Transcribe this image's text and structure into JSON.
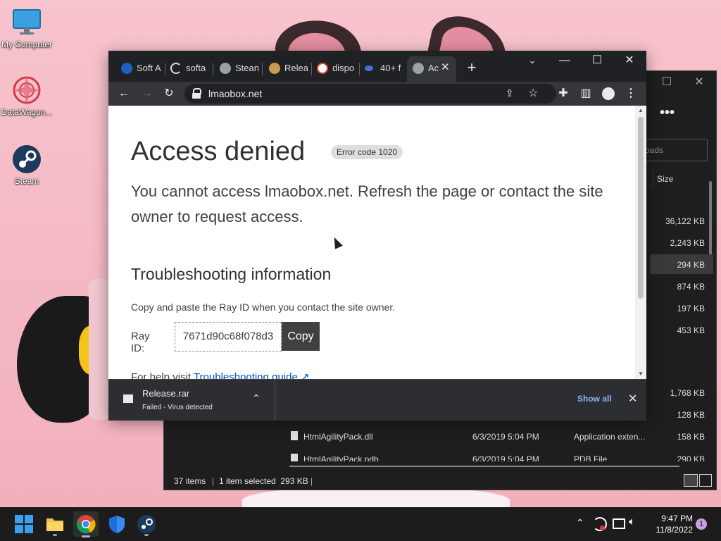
{
  "desktop": {
    "icons": [
      {
        "label": "My Computer",
        "icon": "monitor-icon"
      },
      {
        "label": "DataWagon...",
        "icon": "datawagon-icon"
      },
      {
        "label": "Steam",
        "icon": "steam-icon"
      }
    ]
  },
  "explorer": {
    "search_placeholder": "oads",
    "column_size": "Size",
    "sizes": [
      "36,122 KB",
      "2,243 KB",
      "294 KB",
      "874 KB",
      "197 KB",
      "453 KB",
      "1,768 KB",
      "128 KB"
    ],
    "files": [
      {
        "name": "HtmlAgilityPack.dll",
        "date": "6/3/2019 5:04 PM",
        "type": "Application exten...",
        "size": "158 KB"
      },
      {
        "name": "HtmlAgilityPack.pdb",
        "date": "6/3/2019 5:04 PM",
        "type": "PDB File",
        "size": "290 KB"
      }
    ],
    "status_items": "37 items",
    "status_selected": "1 item selected  293 KB"
  },
  "browser": {
    "tabs": [
      {
        "label": "Soft A",
        "icon": "infinity-icon"
      },
      {
        "label": "softa",
        "icon": "c-logo-icon"
      },
      {
        "label": "Stean",
        "icon": "steam-icon"
      },
      {
        "label": "Relea",
        "icon": "doge-icon"
      },
      {
        "label": "dispo",
        "icon": "google-icon"
      },
      {
        "label": "40+ f",
        "icon": "link-icon"
      },
      {
        "label": "Ac",
        "icon": "globe-icon"
      }
    ],
    "url": "lmaobox.net"
  },
  "page": {
    "title": "Access denied",
    "error_code": "Error code 1020",
    "message": "You cannot access lmaobox.net. Refresh the page or contact the site owner to request access.",
    "troubleshooting_heading": "Troubleshooting information",
    "copy_help": "Copy and paste the Ray ID when you contact the site owner.",
    "ray_label": "Ray ID:",
    "ray_id": "7671d90c68f078d3",
    "copy_button": "Copy",
    "help_prefix": "For help visit",
    "help_link": "Troubleshooting guide ↗"
  },
  "download": {
    "file": "Release.rar",
    "status": "Failed - Virus detected",
    "show_all": "Show all"
  },
  "taskbar": {
    "time": "9:47 PM",
    "date": "11/8/2022",
    "notification_count": "1"
  }
}
